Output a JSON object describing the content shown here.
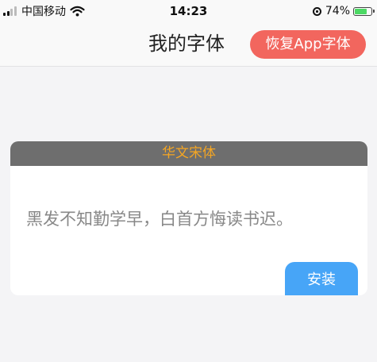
{
  "status_bar": {
    "carrier": "中国移动",
    "time": "14:23",
    "battery_percent": "74%",
    "battery_level": 0.74,
    "signal_bars_active": 2,
    "signal_bars_total": 4,
    "icons": [
      "signal-icon",
      "wifi-icon",
      "orientation-lock-icon",
      "battery-charging-icon"
    ]
  },
  "nav": {
    "title": "我的字体",
    "restore_label": "恢复App字体"
  },
  "font_card": {
    "font_name": "华文宋体",
    "sample_text": "黑发不知勤学早，白首方悔读书迟。",
    "install_label": "安装"
  },
  "colors": {
    "restore_button": "#f2665e",
    "install_button": "#47a5f7",
    "card_header_bg": "#6e6e6e",
    "font_name_text": "#f5a623",
    "page_background": "#f4f4f6"
  }
}
